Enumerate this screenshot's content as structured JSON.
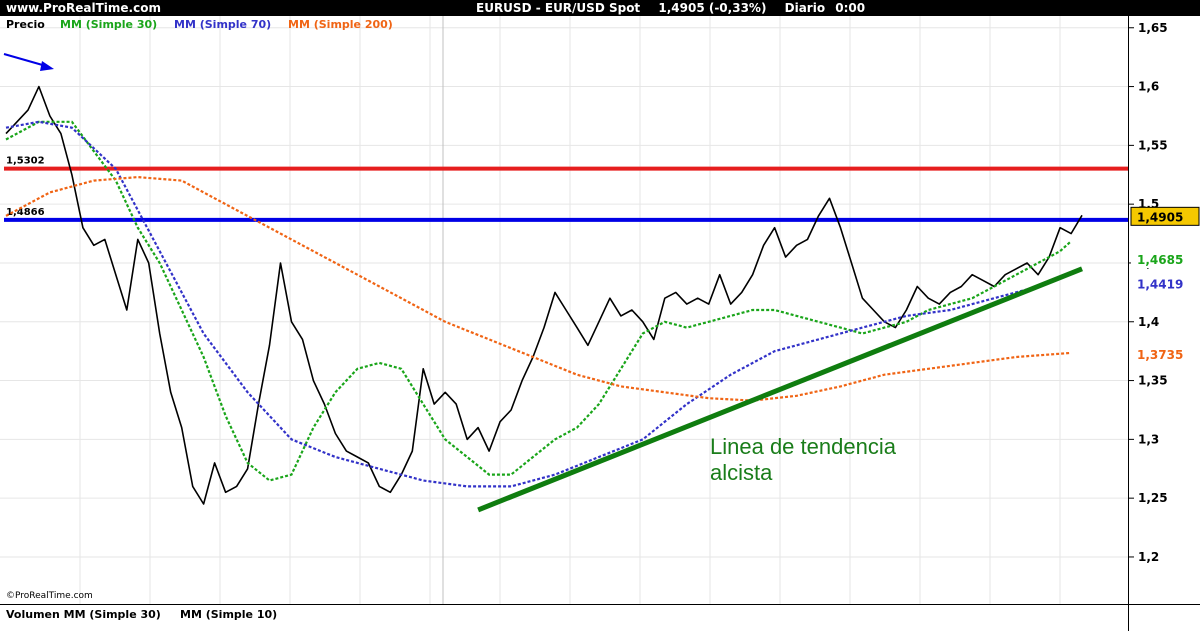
{
  "header": {
    "site": "www.ProRealTime.com",
    "instrument": "EURUSD - EUR/USD Spot",
    "quote": "1,4905 (-0,33%)",
    "timeframe": "Diario",
    "clock": "0:00"
  },
  "legend": {
    "price": "Precio",
    "ma30": "MM (Simple 30)",
    "ma70": "MM (Simple 70)",
    "ma200": "MM (Simple 200)"
  },
  "volume_panel": {
    "label1": "Volumen MM (Simple 30)",
    "label2": "MM (Simple 10)"
  },
  "copyright": "©ProRealTime.com",
  "annotation": {
    "line1": "Linea de tendencia",
    "line2": "alcista"
  },
  "colors": {
    "price": "#000000",
    "ma30": "#1aa51a",
    "ma70": "#3232c8",
    "ma200": "#f06414",
    "resistance": "#e61e1e",
    "support": "#0000e6",
    "trend": "#0f7d0f"
  },
  "chart_data": {
    "type": "line",
    "title": "EURUSD - EUR/USD Spot",
    "ylim": [
      1.16,
      1.66
    ],
    "y_ticks": [
      "1,65",
      "1,6",
      "1,55",
      "1,5",
      "1,45",
      "1,4",
      "1,35",
      "1,3",
      "1,25",
      "1,2"
    ],
    "tick_values": [
      1.65,
      1.6,
      1.55,
      1.5,
      1.45,
      1.4,
      1.35,
      1.3,
      1.25,
      1.2
    ],
    "grid": true,
    "x_index_range": [
      0,
      100
    ],
    "series": [
      {
        "name": "Precio",
        "key": "price",
        "x": [
          0,
          2,
          3,
          4,
          5,
          6,
          7,
          8,
          9,
          10,
          11,
          12,
          13,
          14,
          15,
          16,
          17,
          18,
          19,
          20,
          21,
          22,
          23,
          24,
          25,
          26,
          27,
          28,
          29,
          30,
          31,
          32,
          33,
          34,
          35,
          36,
          37,
          38,
          39,
          40,
          41,
          42,
          43,
          44,
          45,
          46,
          47,
          48,
          49,
          50,
          51,
          52,
          53,
          54,
          55,
          56,
          57,
          58,
          59,
          60,
          61,
          62,
          63,
          64,
          65,
          66,
          67,
          68,
          69,
          70,
          71,
          72,
          73,
          74,
          75,
          76,
          77,
          78,
          79,
          80,
          81,
          82,
          83,
          84,
          85,
          86,
          87,
          88,
          89,
          90,
          91,
          92,
          93,
          94,
          95,
          96,
          97,
          98
        ],
        "y": [
          1.56,
          1.58,
          1.6,
          1.575,
          1.56,
          1.525,
          1.48,
          1.465,
          1.47,
          1.44,
          1.41,
          1.47,
          1.45,
          1.39,
          1.34,
          1.31,
          1.26,
          1.245,
          1.28,
          1.255,
          1.26,
          1.275,
          1.33,
          1.38,
          1.45,
          1.4,
          1.385,
          1.35,
          1.33,
          1.305,
          1.29,
          1.285,
          1.28,
          1.26,
          1.255,
          1.27,
          1.29,
          1.36,
          1.33,
          1.34,
          1.33,
          1.3,
          1.31,
          1.29,
          1.315,
          1.325,
          1.35,
          1.37,
          1.395,
          1.425,
          1.41,
          1.395,
          1.38,
          1.4,
          1.42,
          1.405,
          1.41,
          1.4,
          1.385,
          1.42,
          1.425,
          1.415,
          1.42,
          1.415,
          1.44,
          1.415,
          1.425,
          1.44,
          1.465,
          1.48,
          1.455,
          1.465,
          1.47,
          1.49,
          1.505,
          1.48,
          1.45,
          1.42,
          1.41,
          1.4,
          1.395,
          1.41,
          1.43,
          1.42,
          1.415,
          1.425,
          1.43,
          1.44,
          1.435,
          1.43,
          1.44,
          1.445,
          1.45,
          1.44,
          1.455,
          1.48,
          1.475,
          1.4905
        ]
      },
      {
        "name": "MM (Simple 30)",
        "key": "ma30",
        "x": [
          0,
          3,
          6,
          8,
          10,
          12,
          14,
          16,
          18,
          20,
          22,
          24,
          26,
          28,
          30,
          32,
          34,
          36,
          38,
          40,
          42,
          44,
          46,
          48,
          50,
          52,
          54,
          56,
          58,
          60,
          62,
          64,
          66,
          68,
          70,
          72,
          74,
          76,
          78,
          80,
          82,
          84,
          86,
          88,
          90,
          92,
          94,
          96,
          97
        ],
        "y": [
          1.555,
          1.57,
          1.57,
          1.545,
          1.52,
          1.48,
          1.45,
          1.41,
          1.37,
          1.32,
          1.28,
          1.265,
          1.27,
          1.31,
          1.34,
          1.36,
          1.365,
          1.36,
          1.33,
          1.3,
          1.285,
          1.27,
          1.27,
          1.285,
          1.3,
          1.31,
          1.33,
          1.36,
          1.39,
          1.4,
          1.395,
          1.4,
          1.405,
          1.41,
          1.41,
          1.405,
          1.4,
          1.395,
          1.39,
          1.395,
          1.4,
          1.41,
          1.415,
          1.42,
          1.43,
          1.44,
          1.45,
          1.46,
          1.4685
        ]
      },
      {
        "name": "MM (Simple 70)",
        "key": "ma70",
        "x": [
          0,
          3,
          6,
          10,
          14,
          18,
          22,
          26,
          30,
          34,
          38,
          42,
          46,
          50,
          54,
          58,
          62,
          66,
          70,
          74,
          78,
          82,
          86,
          90,
          94,
          97
        ],
        "y": [
          1.565,
          1.57,
          1.565,
          1.53,
          1.46,
          1.39,
          1.34,
          1.3,
          1.285,
          1.275,
          1.265,
          1.26,
          1.26,
          1.27,
          1.285,
          1.3,
          1.33,
          1.355,
          1.375,
          1.385,
          1.395,
          1.405,
          1.41,
          1.42,
          1.43,
          1.4419
        ]
      },
      {
        "name": "MM (Simple 200)",
        "key": "ma200",
        "x": [
          0,
          4,
          8,
          12,
          16,
          20,
          24,
          28,
          32,
          36,
          40,
          44,
          48,
          52,
          56,
          60,
          64,
          68,
          72,
          76,
          80,
          84,
          88,
          92,
          97
        ],
        "y": [
          1.49,
          1.51,
          1.52,
          1.523,
          1.52,
          1.5,
          1.48,
          1.46,
          1.44,
          1.42,
          1.4,
          1.385,
          1.37,
          1.355,
          1.345,
          1.34,
          1.335,
          1.333,
          1.337,
          1.345,
          1.355,
          1.36,
          1.365,
          1.37,
          1.3735
        ]
      }
    ],
    "horizontal_lines": [
      {
        "key": "resistance",
        "value": 1.5302,
        "label": "1,5302"
      },
      {
        "key": "support",
        "value": 1.4866,
        "label": "1,4866"
      }
    ],
    "trendline": {
      "x": [
        43,
        98
      ],
      "y": [
        1.24,
        1.445
      ]
    },
    "value_tags": [
      {
        "key": "price",
        "label": "1,4905",
        "value": 1.4905
      },
      {
        "key": "ma30",
        "label": "1,4685",
        "value": 1.4685
      },
      {
        "key": "ma70",
        "label": "1,4419",
        "value": 1.4419
      },
      {
        "key": "ma200",
        "label": "1,3735",
        "value": 1.3735
      }
    ]
  }
}
